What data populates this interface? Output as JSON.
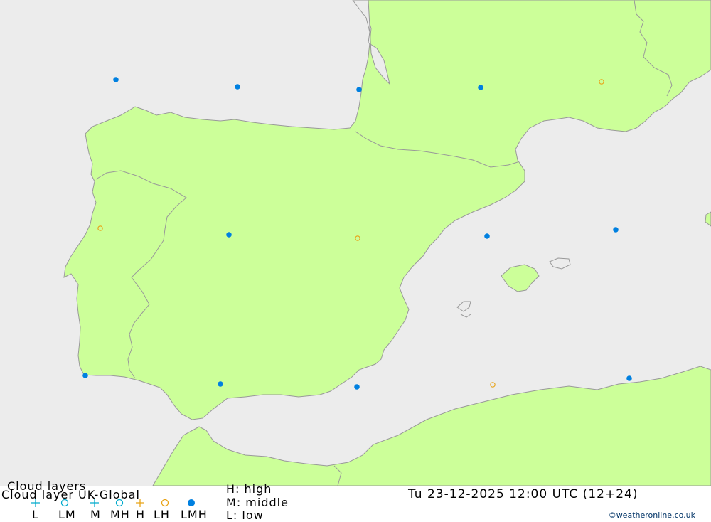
{
  "title_overlay": "Cloud layers",
  "model_title": "Cloud layer  UK-Global",
  "datetime": "Tu 23-12-2025 12:00 UTC (12+24)",
  "credit": "©weatheronline.co.uk",
  "colors": {
    "sea": "#ececec",
    "land": "#ccff99",
    "coast": "#999999",
    "low_cyan": "#00aacc",
    "high_orange": "#e8a317",
    "all_layers_blue": "#0080e0"
  },
  "layer_key": [
    {
      "code": "H",
      "desc": "high"
    },
    {
      "code": "M",
      "desc": "middle"
    },
    {
      "code": "L",
      "desc": "low"
    }
  ],
  "symbol_legend": [
    {
      "label": "L",
      "icon": "cyan-plus-icon"
    },
    {
      "label": "LM",
      "icon": "cyan-circle-icon"
    },
    {
      "label": "M",
      "icon": "cyan-plus-icon"
    },
    {
      "label": "MH",
      "icon": "cyan-circle-icon"
    },
    {
      "label": "H",
      "icon": "orange-plus-icon"
    },
    {
      "label": "LH",
      "icon": "orange-circle-icon"
    },
    {
      "label": "LMH",
      "icon": "blue-filled-dot-icon"
    }
  ],
  "markers": [
    {
      "type": "LMH"
    },
    {
      "type": "LMH"
    },
    {
      "type": "LMH"
    },
    {
      "type": "LMH"
    },
    {
      "type": "LH"
    },
    {
      "type": "LH"
    },
    {
      "type": "LMH"
    },
    {
      "type": "LH"
    },
    {
      "type": "LMH"
    },
    {
      "type": "LMH"
    },
    {
      "type": "LMH"
    },
    {
      "type": "LMH"
    },
    {
      "type": "LMH"
    },
    {
      "type": "LH"
    },
    {
      "type": "LMH"
    }
  ]
}
